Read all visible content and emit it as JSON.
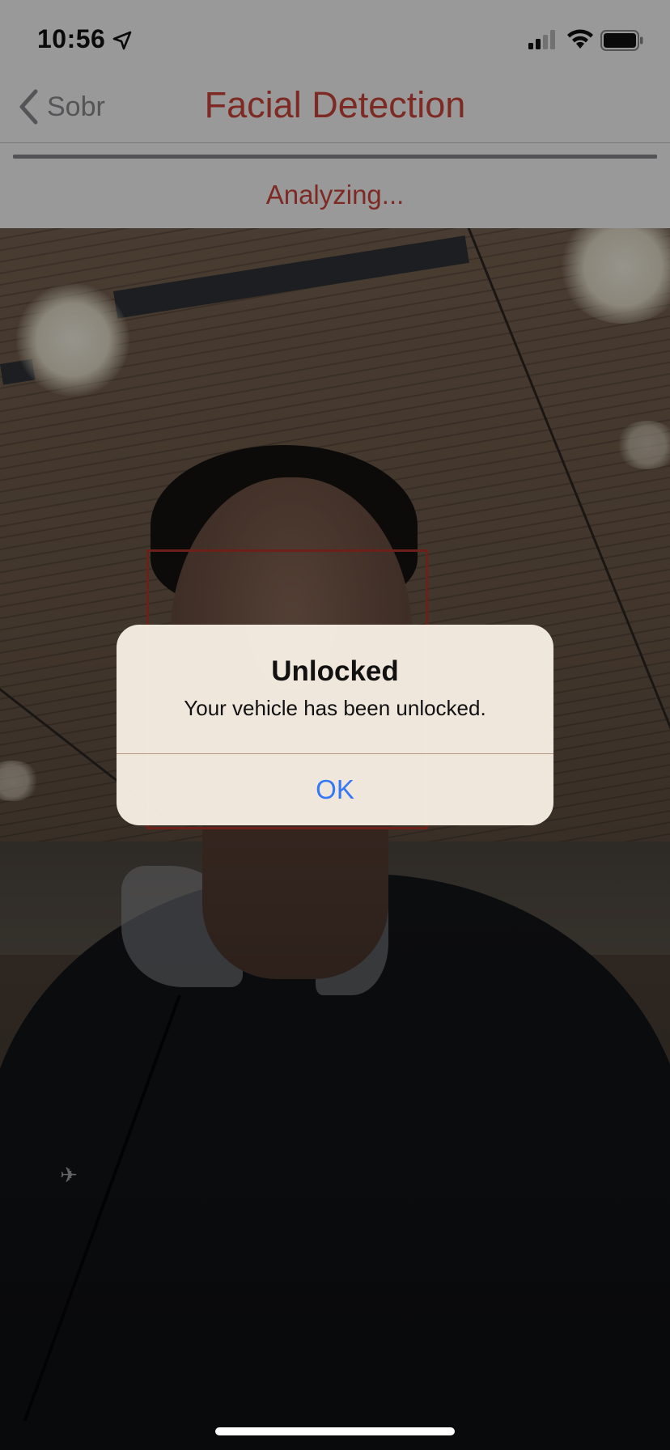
{
  "status_bar": {
    "time": "10:56",
    "icons": [
      "location-arrow-icon",
      "cellular-signal-icon",
      "wifi-icon",
      "battery-icon"
    ]
  },
  "nav": {
    "back_label": "Sobr",
    "back_icon": "chevron-left-icon",
    "title": "Facial Detection"
  },
  "progress": {
    "value": 1.0
  },
  "status_text": "Analyzing...",
  "alert": {
    "title": "Unlocked",
    "message": "Your vehicle has been unlocked.",
    "ok_label": "OK"
  },
  "colors": {
    "accent": "#d2473c",
    "link": "#3478f6",
    "face_box": "#b3362c"
  }
}
